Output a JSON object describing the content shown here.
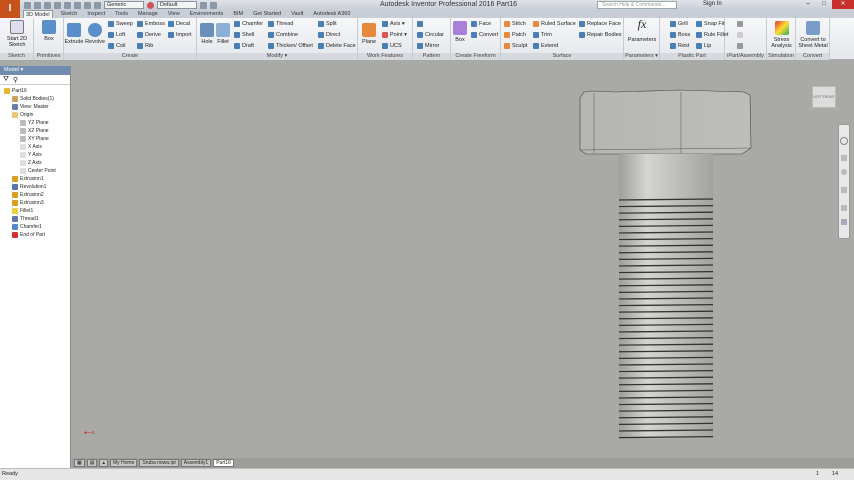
{
  "app": {
    "title": "Autodesk Inventor Professional 2016    Part16",
    "search_placeholder": "Search Help & Commands...",
    "sign_in": "Sign In",
    "material": "Generic",
    "appearance": "Default"
  },
  "tabs": [
    "3D Model",
    "Sketch",
    "Inspect",
    "Tools",
    "Manage",
    "View",
    "Environments",
    "BIM",
    "Get Started",
    "Vault",
    "Autodesk A360"
  ],
  "ribbon": {
    "sketch": {
      "label": "Sketch",
      "start": "Start 2D Sketch"
    },
    "primitives": {
      "label": "Primitives",
      "box": "Box"
    },
    "create": {
      "label": "Create",
      "extrude": "Extrude",
      "revolve": "Revolve",
      "sweep": "Sweep",
      "loft": "Loft",
      "coil": "Coil",
      "emboss": "Emboss",
      "derive": "Derive",
      "rib": "Rib",
      "decal": "Decal",
      "import": "Import"
    },
    "modify": {
      "label": "Modify ▾",
      "hole": "Hole",
      "fillet": "Fillet",
      "chamfer": "Chamfer",
      "shell": "Shell",
      "draft": "Draft",
      "thread": "Thread",
      "combine": "Combine",
      "thicken": "Thicken/ Offset",
      "split": "Split",
      "direct": "Direct",
      "delete_face": "Delete Face"
    },
    "work": {
      "label": "Work Features",
      "plane": "Plane",
      "axis": "Axis ▾",
      "point": "Point ▾",
      "ucs": "UCS"
    },
    "pattern": {
      "label": "Pattern",
      "circular": "Circular",
      "mirror": "Mirror"
    },
    "freeform": {
      "label": "Create Freeform",
      "box": "Box",
      "face": "Face",
      "convert": "Convert"
    },
    "surface": {
      "label": "Surface",
      "stitch": "Stitch",
      "patch": "Patch",
      "sculpt": "Sculpt",
      "ruled": "Ruled Surface",
      "trim": "Trim",
      "extend": "Extend",
      "replace": "Replace Face",
      "repair": "Repair Bodies"
    },
    "parameters": {
      "label": "Parameters ▾",
      "parameters": "Parameters"
    },
    "plastic": {
      "label": "Plastic Part",
      "grill": "Grill",
      "boss": "Boss",
      "rest": "Rest",
      "snap": "Snap Fit",
      "rule_fillet": "Rule Fillet",
      "lip": "Lip"
    },
    "ipart": {
      "label": "iPart/Assembly"
    },
    "simulation": {
      "label": "Simulation",
      "stress": "Stress Analysis"
    },
    "convert": {
      "label": "Convert",
      "sheet": "Convert to Sheet Metal"
    }
  },
  "browser": {
    "title": "Model ▾",
    "nodes": [
      {
        "label": "Part16",
        "color": "#e8b830",
        "indent": 0
      },
      {
        "label": "Solid Bodies(1)",
        "color": "#c9a060",
        "indent": 1
      },
      {
        "label": "View: Master",
        "color": "#6a7fa8",
        "indent": 1
      },
      {
        "label": "Origin",
        "color": "#e8c870",
        "indent": 1
      },
      {
        "label": "YZ Plane",
        "color": "#bbbbbb",
        "indent": 2
      },
      {
        "label": "XZ Plane",
        "color": "#bbbbbb",
        "indent": 2
      },
      {
        "label": "XY Plane",
        "color": "#bbbbbb",
        "indent": 2
      },
      {
        "label": "X Axis",
        "color": "#dddddd",
        "indent": 2
      },
      {
        "label": "Y Axis",
        "color": "#dddddd",
        "indent": 2
      },
      {
        "label": "Z Axis",
        "color": "#dddddd",
        "indent": 2
      },
      {
        "label": "Center Point",
        "color": "#dddddd",
        "indent": 2
      },
      {
        "label": "Extrusion1",
        "color": "#d4a020",
        "indent": 1
      },
      {
        "label": "Revolution1",
        "color": "#5577aa",
        "indent": 1
      },
      {
        "label": "Extrusion2",
        "color": "#d4a020",
        "indent": 1
      },
      {
        "label": "Extrusion3",
        "color": "#d4a020",
        "indent": 1
      },
      {
        "label": "Fillet1",
        "color": "#e8d040",
        "indent": 1
      },
      {
        "label": "Thread1",
        "color": "#6677aa",
        "indent": 1
      },
      {
        "label": "Chamfer1",
        "color": "#5588cc",
        "indent": 1
      },
      {
        "label": "End of Part",
        "color": "#d03030",
        "indent": 1
      }
    ]
  },
  "viewcube": {
    "left": "LEFT",
    "front": "FRONT"
  },
  "doc_tabs": [
    "My Home",
    "Sruba nowa.ipt",
    "Assembly1",
    "Part16"
  ],
  "active_doc": "Part16",
  "status": {
    "text": "Ready",
    "count1": "1",
    "count2": "14"
  }
}
